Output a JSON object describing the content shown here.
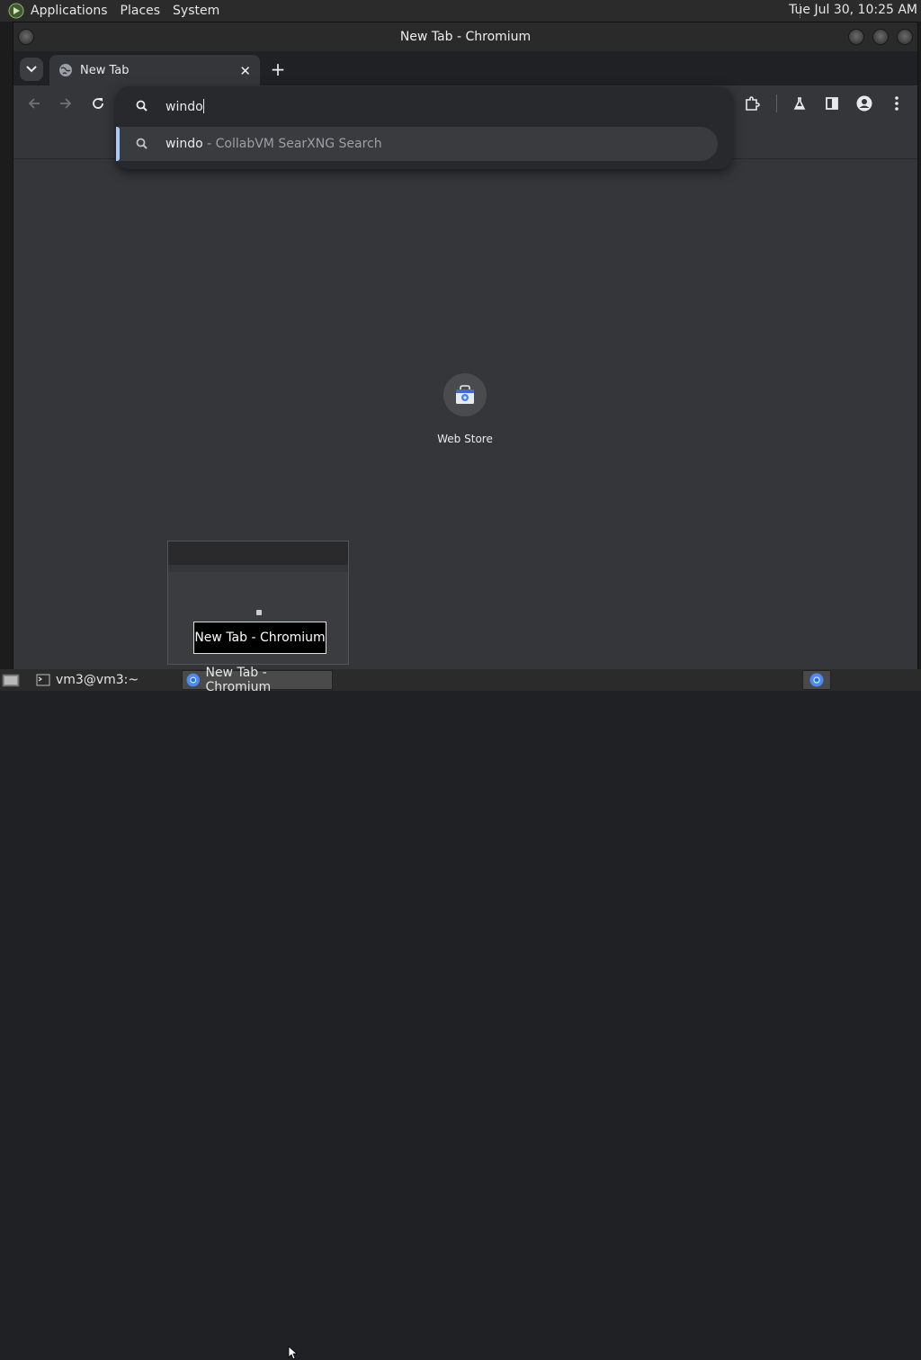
{
  "top_panel": {
    "menus": [
      "Applications",
      "Places",
      "System"
    ],
    "clock": "Tue Jul 30, 10:25 AM"
  },
  "window": {
    "title": "New Tab - Chromium"
  },
  "tabs": [
    {
      "label": "New Tab",
      "active": true
    }
  ],
  "omnibox": {
    "input_value": "windo",
    "suggestion": {
      "query": "windo",
      "description": " - CollabVM SearXNG Search"
    }
  },
  "page": {
    "shortcuts": [
      {
        "label": "Web Store",
        "icon": "webstore-icon"
      }
    ]
  },
  "preview_tooltip": "New Tab - Chromium",
  "taskbar": {
    "items": [
      {
        "label": "vm3@vm3:~",
        "icon": "terminal-icon"
      },
      {
        "label": "New Tab - Chromium",
        "icon": "chromium-icon",
        "active": true
      }
    ]
  },
  "colors": {
    "accent": "#a8c7fa",
    "page_bg": "#35363a",
    "omnibox_bg": "#28292c"
  }
}
